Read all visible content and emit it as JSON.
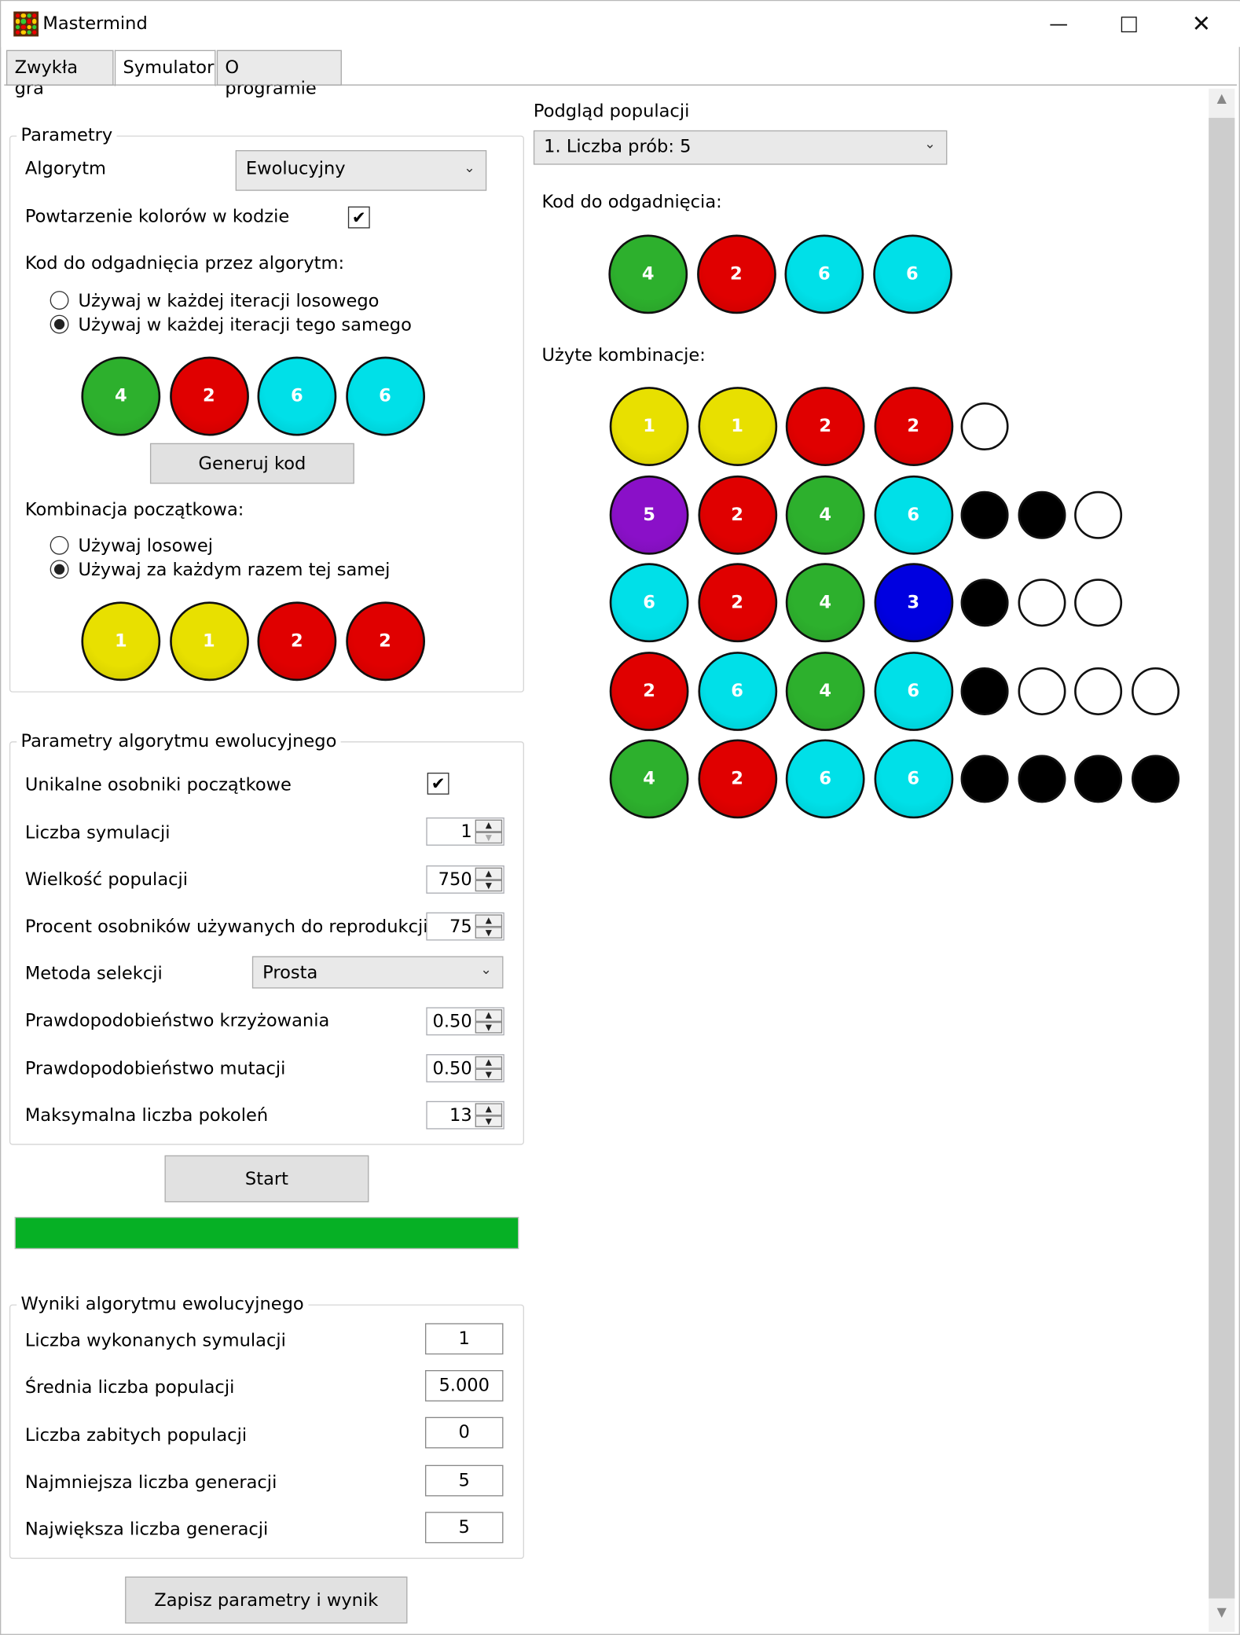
{
  "window": {
    "title": "Mastermind"
  },
  "tabs": [
    {
      "label": "Zwykła gra"
    },
    {
      "label": "Symulator"
    },
    {
      "label": "O programie"
    }
  ],
  "params": {
    "legend": "Parametry",
    "algorithm_label": "Algorytm",
    "algorithm_value": "Ewolucyjny",
    "repeat_label": "Powtarzenie kolorów w kodzie",
    "repeat_checked": true,
    "code_label": "Kod do odgadnięcia przez algorytm:",
    "code_option_random": "Używaj w każdej iteracji losowego",
    "code_option_same": "Używaj w każdej iteracji tego samego",
    "code_selected": "same",
    "code_pegs": [
      {
        "n": "4",
        "color": "#2db02d"
      },
      {
        "n": "2",
        "color": "#e00000"
      },
      {
        "n": "6",
        "color": "#00e0e8"
      },
      {
        "n": "6",
        "color": "#00e0e8"
      }
    ],
    "generate_button": "Generuj kod",
    "initial_label": "Kombinacja początkowa:",
    "initial_option_random": "Używaj losowej",
    "initial_option_same": "Używaj za każdym razem tej samej",
    "initial_selected": "same",
    "initial_pegs": [
      {
        "n": "1",
        "color": "#e8e000"
      },
      {
        "n": "1",
        "color": "#e8e000"
      },
      {
        "n": "2",
        "color": "#e00000"
      },
      {
        "n": "2",
        "color": "#e00000"
      }
    ]
  },
  "evo": {
    "legend": "Parametry algorytmu ewolucyjnego",
    "unique_label": "Unikalne osobniki początkowe",
    "unique_checked": true,
    "sims_label": "Liczba symulacji",
    "sims_value": "1",
    "pop_label": "Wielkość populacji",
    "pop_value": "750",
    "repro_label": "Procent osobników używanych do reprodukcji",
    "repro_value": "75",
    "selection_label": "Metoda selekcji",
    "selection_value": "Prosta",
    "cross_label": "Prawdopodobieństwo krzyżowania",
    "cross_value": "0.50",
    "mut_label": "Prawdopodobieństwo mutacji",
    "mut_value": "0.50",
    "gen_label": "Maksymalna liczba pokoleń",
    "gen_value": "13"
  },
  "start_button": "Start",
  "progress": {
    "value": 1.0,
    "color": "#06b025"
  },
  "results": {
    "legend": "Wyniki algorytmu ewolucyjnego",
    "done_label": "Liczba wykonanych symulacji",
    "done_value": "1",
    "avg_label": "Średnia liczba populacji",
    "avg_value": "5.000",
    "killed_label": "Liczba zabitych populacji",
    "killed_value": "0",
    "min_label": "Najmniejsza liczba generacji",
    "min_value": "5",
    "max_label": "Największa liczba generacji",
    "max_value": "5"
  },
  "save_button": "Zapisz parametry i wynik",
  "preview": {
    "title": "Podgląd populacji",
    "select_value": "1. Liczba prób: 5",
    "code_label": "Kod do odgadnięcia:",
    "code_pegs": [
      {
        "n": "4",
        "color": "#2db02d"
      },
      {
        "n": "2",
        "color": "#e00000"
      },
      {
        "n": "6",
        "color": "#00e0e8"
      },
      {
        "n": "6",
        "color": "#00e0e8"
      }
    ],
    "used_label": "Użyte kombinacje:",
    "rows": [
      {
        "pegs": [
          {
            "n": "1",
            "color": "#e8e000"
          },
          {
            "n": "1",
            "color": "#e8e000"
          },
          {
            "n": "2",
            "color": "#e00000"
          },
          {
            "n": "2",
            "color": "#e00000"
          }
        ],
        "pins": [
          "white"
        ]
      },
      {
        "pegs": [
          {
            "n": "5",
            "color": "#8a10c8"
          },
          {
            "n": "2",
            "color": "#e00000"
          },
          {
            "n": "4",
            "color": "#2db02d"
          },
          {
            "n": "6",
            "color": "#00e0e8"
          }
        ],
        "pins": [
          "black",
          "black",
          "white"
        ]
      },
      {
        "pegs": [
          {
            "n": "6",
            "color": "#00e0e8"
          },
          {
            "n": "2",
            "color": "#e00000"
          },
          {
            "n": "4",
            "color": "#2db02d"
          },
          {
            "n": "3",
            "color": "#0000e0"
          }
        ],
        "pins": [
          "black",
          "white",
          "white"
        ]
      },
      {
        "pegs": [
          {
            "n": "2",
            "color": "#e00000"
          },
          {
            "n": "6",
            "color": "#00e0e8"
          },
          {
            "n": "4",
            "color": "#2db02d"
          },
          {
            "n": "6",
            "color": "#00e0e8"
          }
        ],
        "pins": [
          "black",
          "white",
          "white",
          "white"
        ]
      },
      {
        "pegs": [
          {
            "n": "4",
            "color": "#2db02d"
          },
          {
            "n": "2",
            "color": "#e00000"
          },
          {
            "n": "6",
            "color": "#00e0e8"
          },
          {
            "n": "6",
            "color": "#00e0e8"
          }
        ],
        "pins": [
          "black",
          "black",
          "black",
          "black"
        ]
      }
    ]
  }
}
